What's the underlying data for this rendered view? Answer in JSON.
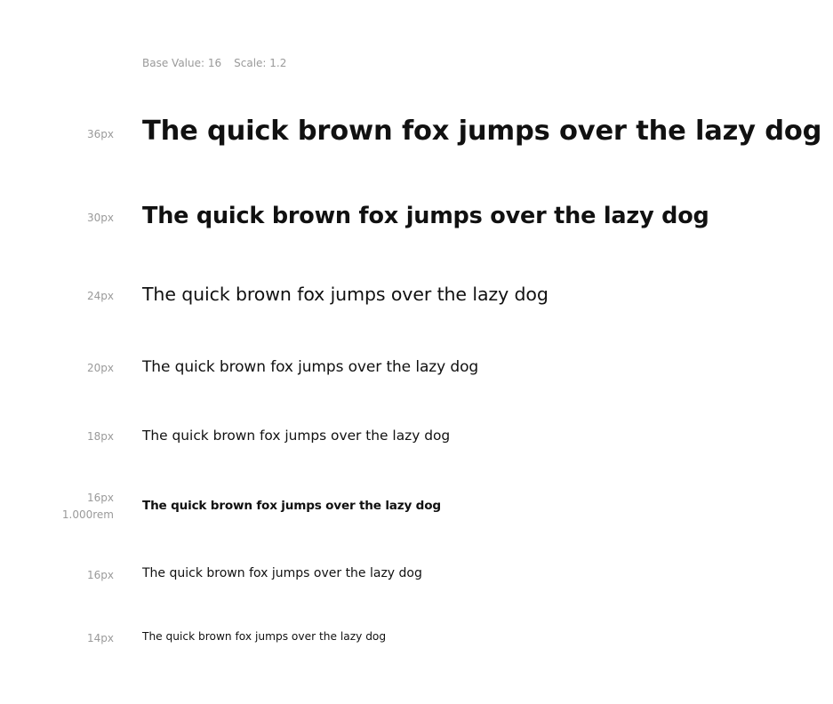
{
  "header": {
    "base_value": "Base Value: 16",
    "scale": "Scale: 1.2"
  },
  "rows": [
    {
      "size": "36px",
      "rem": "",
      "text": "The quick brown fox jumps over the lazy dog"
    },
    {
      "size": "30px",
      "rem": "",
      "text": "The quick brown fox jumps over the lazy dog"
    },
    {
      "size": "24px",
      "rem": "",
      "text": "The quick brown fox jumps over the lazy dog"
    },
    {
      "size": "20px",
      "rem": "",
      "text": "The quick brown fox jumps over the lazy dog"
    },
    {
      "size": "18px",
      "rem": "",
      "text": "The quick brown fox jumps over the lazy dog"
    },
    {
      "size": "16px",
      "rem": "1.000rem",
      "text": "The quick brown fox jumps over the lazy dog"
    },
    {
      "size": "16px",
      "rem": "",
      "text": "The quick brown fox jumps over the lazy dog"
    },
    {
      "size": "14px",
      "rem": "",
      "text": "The quick brown fox jumps over the lazy dog"
    }
  ]
}
